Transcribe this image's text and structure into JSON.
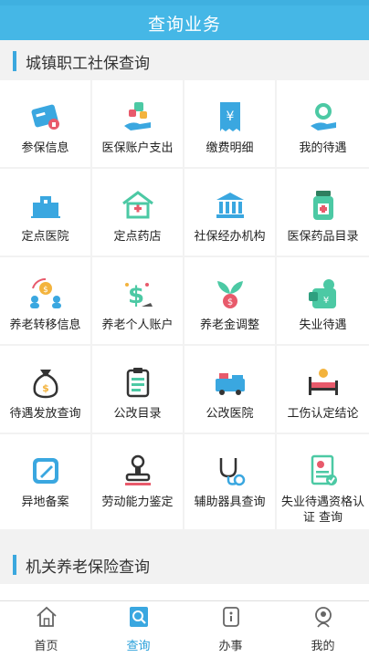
{
  "header": {
    "title": "查询业务"
  },
  "sections": [
    {
      "title": "城镇职工社保查询"
    },
    {
      "title": "机关养老保险查询"
    }
  ],
  "items": [
    {
      "label": "参保信息",
      "icon": "id-card-icon"
    },
    {
      "label": "医保账户支出",
      "icon": "medical-account-icon"
    },
    {
      "label": "缴费明细",
      "icon": "payment-receipt-icon"
    },
    {
      "label": "我的待遇",
      "icon": "benefit-hand-icon"
    },
    {
      "label": "定点医院",
      "icon": "hospital-icon"
    },
    {
      "label": "定点药店",
      "icon": "pharmacy-icon"
    },
    {
      "label": "社保经办机构",
      "icon": "institution-icon"
    },
    {
      "label": "医保药品目录",
      "icon": "medicine-jar-icon"
    },
    {
      "label": "养老转移信息",
      "icon": "transfer-people-icon"
    },
    {
      "label": "养老个人账户",
      "icon": "pension-account-icon"
    },
    {
      "label": "养老金调整",
      "icon": "money-plant-icon"
    },
    {
      "label": "失业待遇",
      "icon": "unemployment-icon"
    },
    {
      "label": "待遇发放查询",
      "icon": "money-bag-icon"
    },
    {
      "label": "公改目录",
      "icon": "clipboard-icon"
    },
    {
      "label": "公改医院",
      "icon": "ambulance-icon"
    },
    {
      "label": "工伤认定结论",
      "icon": "injury-bed-icon"
    },
    {
      "label": "异地备案",
      "icon": "edit-pencil-icon"
    },
    {
      "label": "劳动能力鉴定",
      "icon": "stamp-icon"
    },
    {
      "label": "辅助器具查询",
      "icon": "stethoscope-icon"
    },
    {
      "label": "失业待遇资格认证 查询",
      "icon": "document-check-icon"
    }
  ],
  "tabs": [
    {
      "label": "首页",
      "icon": "home-icon"
    },
    {
      "label": "查询",
      "icon": "query-icon"
    },
    {
      "label": "办事",
      "icon": "service-icon"
    },
    {
      "label": "我的",
      "icon": "profile-icon"
    }
  ],
  "colors": {
    "header": "#45b7e6",
    "accent": "#2aa0da",
    "icon_blue": "#3aa7e0",
    "icon_green": "#4cc9a4"
  }
}
